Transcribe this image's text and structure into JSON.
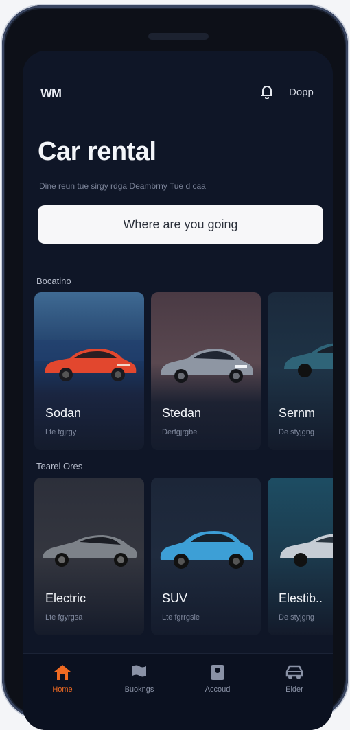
{
  "app": {
    "brand": "WM",
    "user_label": "Dopp",
    "title": "Car rental",
    "subtitle": "Dine reun tue sirgy rdga Deambrny Tue d caa",
    "search_placeholder": "Where are you going"
  },
  "section1": {
    "label": "Bocatino",
    "cards": [
      {
        "name": "Sodan",
        "desc": "Lte tgjrgy",
        "car_color": "#e2472e"
      },
      {
        "name": "Stedan",
        "desc": "Derfgjrgbe",
        "car_color": "#8e96a3"
      },
      {
        "name": "Sernm",
        "desc": "De styjgng",
        "car_color": "#2f6478"
      }
    ]
  },
  "section2": {
    "label": "Tearel Ores",
    "cards": [
      {
        "name": "Electric",
        "desc": "Lte fgyrgsa",
        "car_color": "#7d8289"
      },
      {
        "name": "SUV",
        "desc": "Lte fgrrgsle",
        "car_color": "#3d9fd6"
      },
      {
        "name": "Elestib..",
        "desc": "De styjgng",
        "car_color": "#c6ccd4"
      }
    ]
  },
  "nav": {
    "items": [
      {
        "label": "Home",
        "icon": "home-icon",
        "active": true
      },
      {
        "label": "Buokngs",
        "icon": "flag-icon",
        "active": false
      },
      {
        "label": "Accoud",
        "icon": "account-icon",
        "active": false
      },
      {
        "label": "Elder",
        "icon": "car-icon",
        "active": false
      }
    ]
  },
  "colors": {
    "accent": "#ef6a22",
    "background": "#0f1627",
    "search_bg": "#f7f7f9"
  }
}
